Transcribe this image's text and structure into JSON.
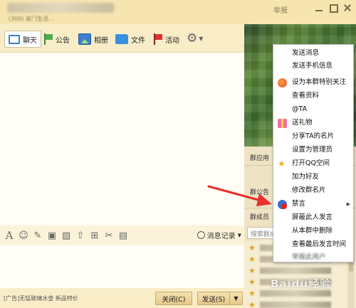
{
  "window": {
    "title": "",
    "subtitle": "(300) 家门生活…",
    "report_label": "举报"
  },
  "tabs": [
    {
      "label": "聊天",
      "icon": "chat-icon",
      "active": true
    },
    {
      "label": "公告",
      "icon": "flag-icon"
    },
    {
      "label": "相册",
      "icon": "photo-icon"
    },
    {
      "label": "文件",
      "icon": "folder-icon"
    },
    {
      "label": "活动",
      "icon": "red-flag-icon"
    }
  ],
  "toolbar": {
    "font_icon": "A",
    "emoji_icon": "☺",
    "message_record_label": "消息记录"
  },
  "bottom": {
    "ad_text": "[广告]无锰玻璃水壶 新品特价",
    "close_label": "关闭(C)",
    "send_label": "发送(S)"
  },
  "right_panel": {
    "apps_label": "群应用",
    "notice_label": "群公告",
    "members_label": "群成员",
    "search_placeholder": "搜索群成员"
  },
  "context_menu": {
    "items": [
      {
        "label": "发送消息"
      },
      {
        "label": "发送手机信息"
      },
      {
        "label": "设为本群特别关注",
        "icon": "heart-icon"
      },
      {
        "label": "查看资料"
      },
      {
        "label": "@TA"
      },
      {
        "label": "送礼物",
        "icon": "gift-icon"
      },
      {
        "label": "分享TA的名片"
      },
      {
        "label": "设置为管理员"
      },
      {
        "label": "打开QQ空间",
        "icon": "star-icon"
      },
      {
        "label": "加为好友"
      },
      {
        "label": "修改群名片"
      },
      {
        "label": "禁言",
        "icon": "ban-icon",
        "submenu": true
      },
      {
        "label": "屏蔽此人发言"
      },
      {
        "label": "从本群中删除"
      },
      {
        "label": "查看最后发言时间"
      },
      {
        "label": "举报此用户"
      }
    ]
  },
  "watermark": "Baidu经验",
  "colors": {
    "titlebar": "#f7e5b0",
    "panel": "#fbf3d9",
    "arrow": "#e8302c"
  }
}
